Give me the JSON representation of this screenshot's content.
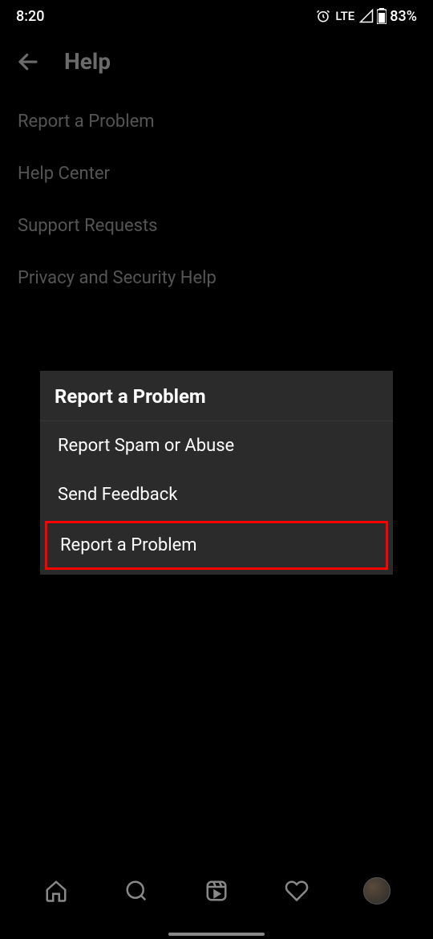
{
  "status": {
    "time": "8:20",
    "network": "LTE",
    "battery": "83%"
  },
  "header": {
    "title": "Help"
  },
  "menu": {
    "items": [
      "Report a Problem",
      "Help Center",
      "Support Requests",
      "Privacy and Security Help"
    ]
  },
  "dialog": {
    "title": "Report a Problem",
    "options": [
      "Report Spam or Abuse",
      "Send Feedback",
      "Report a Problem"
    ]
  }
}
